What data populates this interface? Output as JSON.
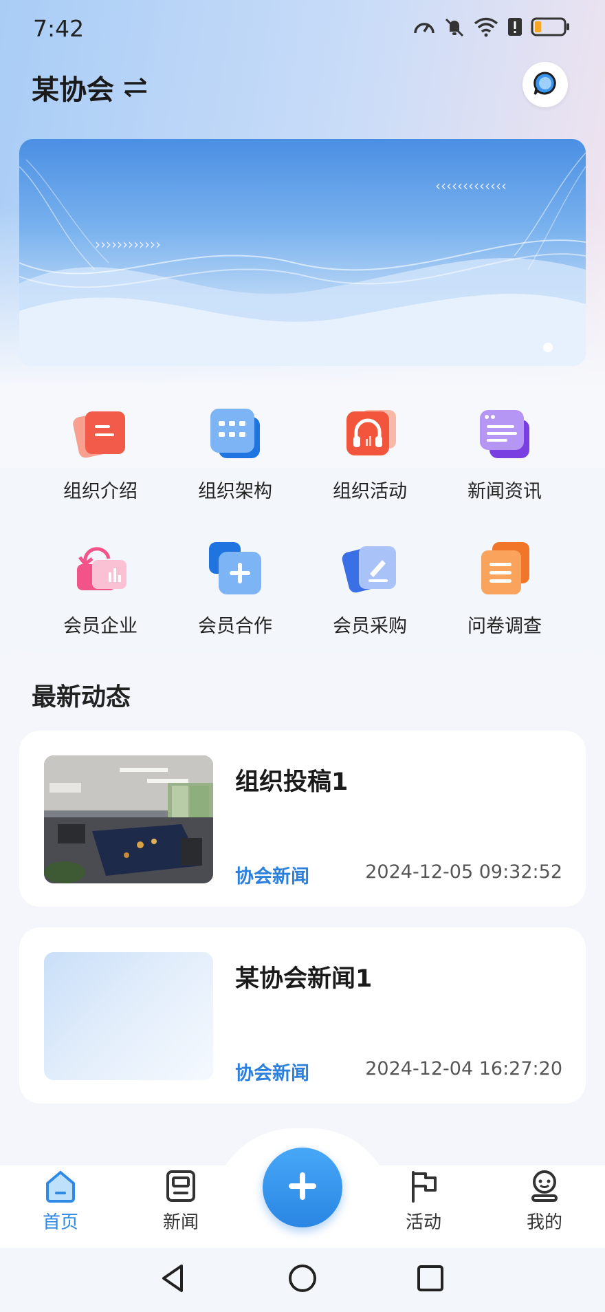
{
  "status_bar": {
    "time": "7:42",
    "icons": [
      "speed-icon",
      "mute-bell-icon",
      "wifi-icon",
      "alert-icon",
      "battery-icon"
    ]
  },
  "header": {
    "title": "某协会",
    "switch_icon": "swap-arrows-icon",
    "chat_icon": "chat-bubble-icon"
  },
  "banner": {
    "slides": 1,
    "active_slide": 1
  },
  "functions": [
    [
      {
        "label": "组织介绍",
        "icon": "org-intro-icon",
        "color": "#f25b4a"
      },
      {
        "label": "组织架构",
        "icon": "org-structure-icon",
        "color": "#3a8df0"
      },
      {
        "label": "组织活动",
        "icon": "org-activity-icon",
        "color": "#f2553c"
      },
      {
        "label": "新闻资讯",
        "icon": "news-info-icon",
        "color": "#8a5cf0"
      }
    ],
    [
      {
        "label": "会员企业",
        "icon": "member-company-icon",
        "color": "#f2548a"
      },
      {
        "label": "会员合作",
        "icon": "member-cooperation-icon",
        "color": "#3a8df0"
      },
      {
        "label": "会员采购",
        "icon": "member-purchase-icon",
        "color": "#4a7ff0"
      },
      {
        "label": "问卷调查",
        "icon": "survey-icon",
        "color": "#f58a30"
      }
    ]
  ],
  "news": {
    "section_title": "最新动态",
    "items": [
      {
        "title": "组织投稿1",
        "category": "协会新闻",
        "date": "2024-12-05 09:32:52",
        "thumb": "office-photo"
      },
      {
        "title": "某协会新闻1",
        "category": "协会新闻",
        "date": "2024-12-04 16:27:20",
        "thumb": "blank-placeholder"
      }
    ]
  },
  "bottom_nav": {
    "items": [
      {
        "label": "首页",
        "icon": "home-icon",
        "active": true
      },
      {
        "label": "新闻",
        "icon": "news-icon",
        "active": false
      },
      {
        "label": "活动",
        "icon": "flag-icon",
        "active": false
      },
      {
        "label": "我的",
        "icon": "profile-icon",
        "active": false
      }
    ],
    "fab_icon": "plus-icon"
  },
  "colors": {
    "accent": "#2f8ae6",
    "category": "#2a80dc"
  }
}
